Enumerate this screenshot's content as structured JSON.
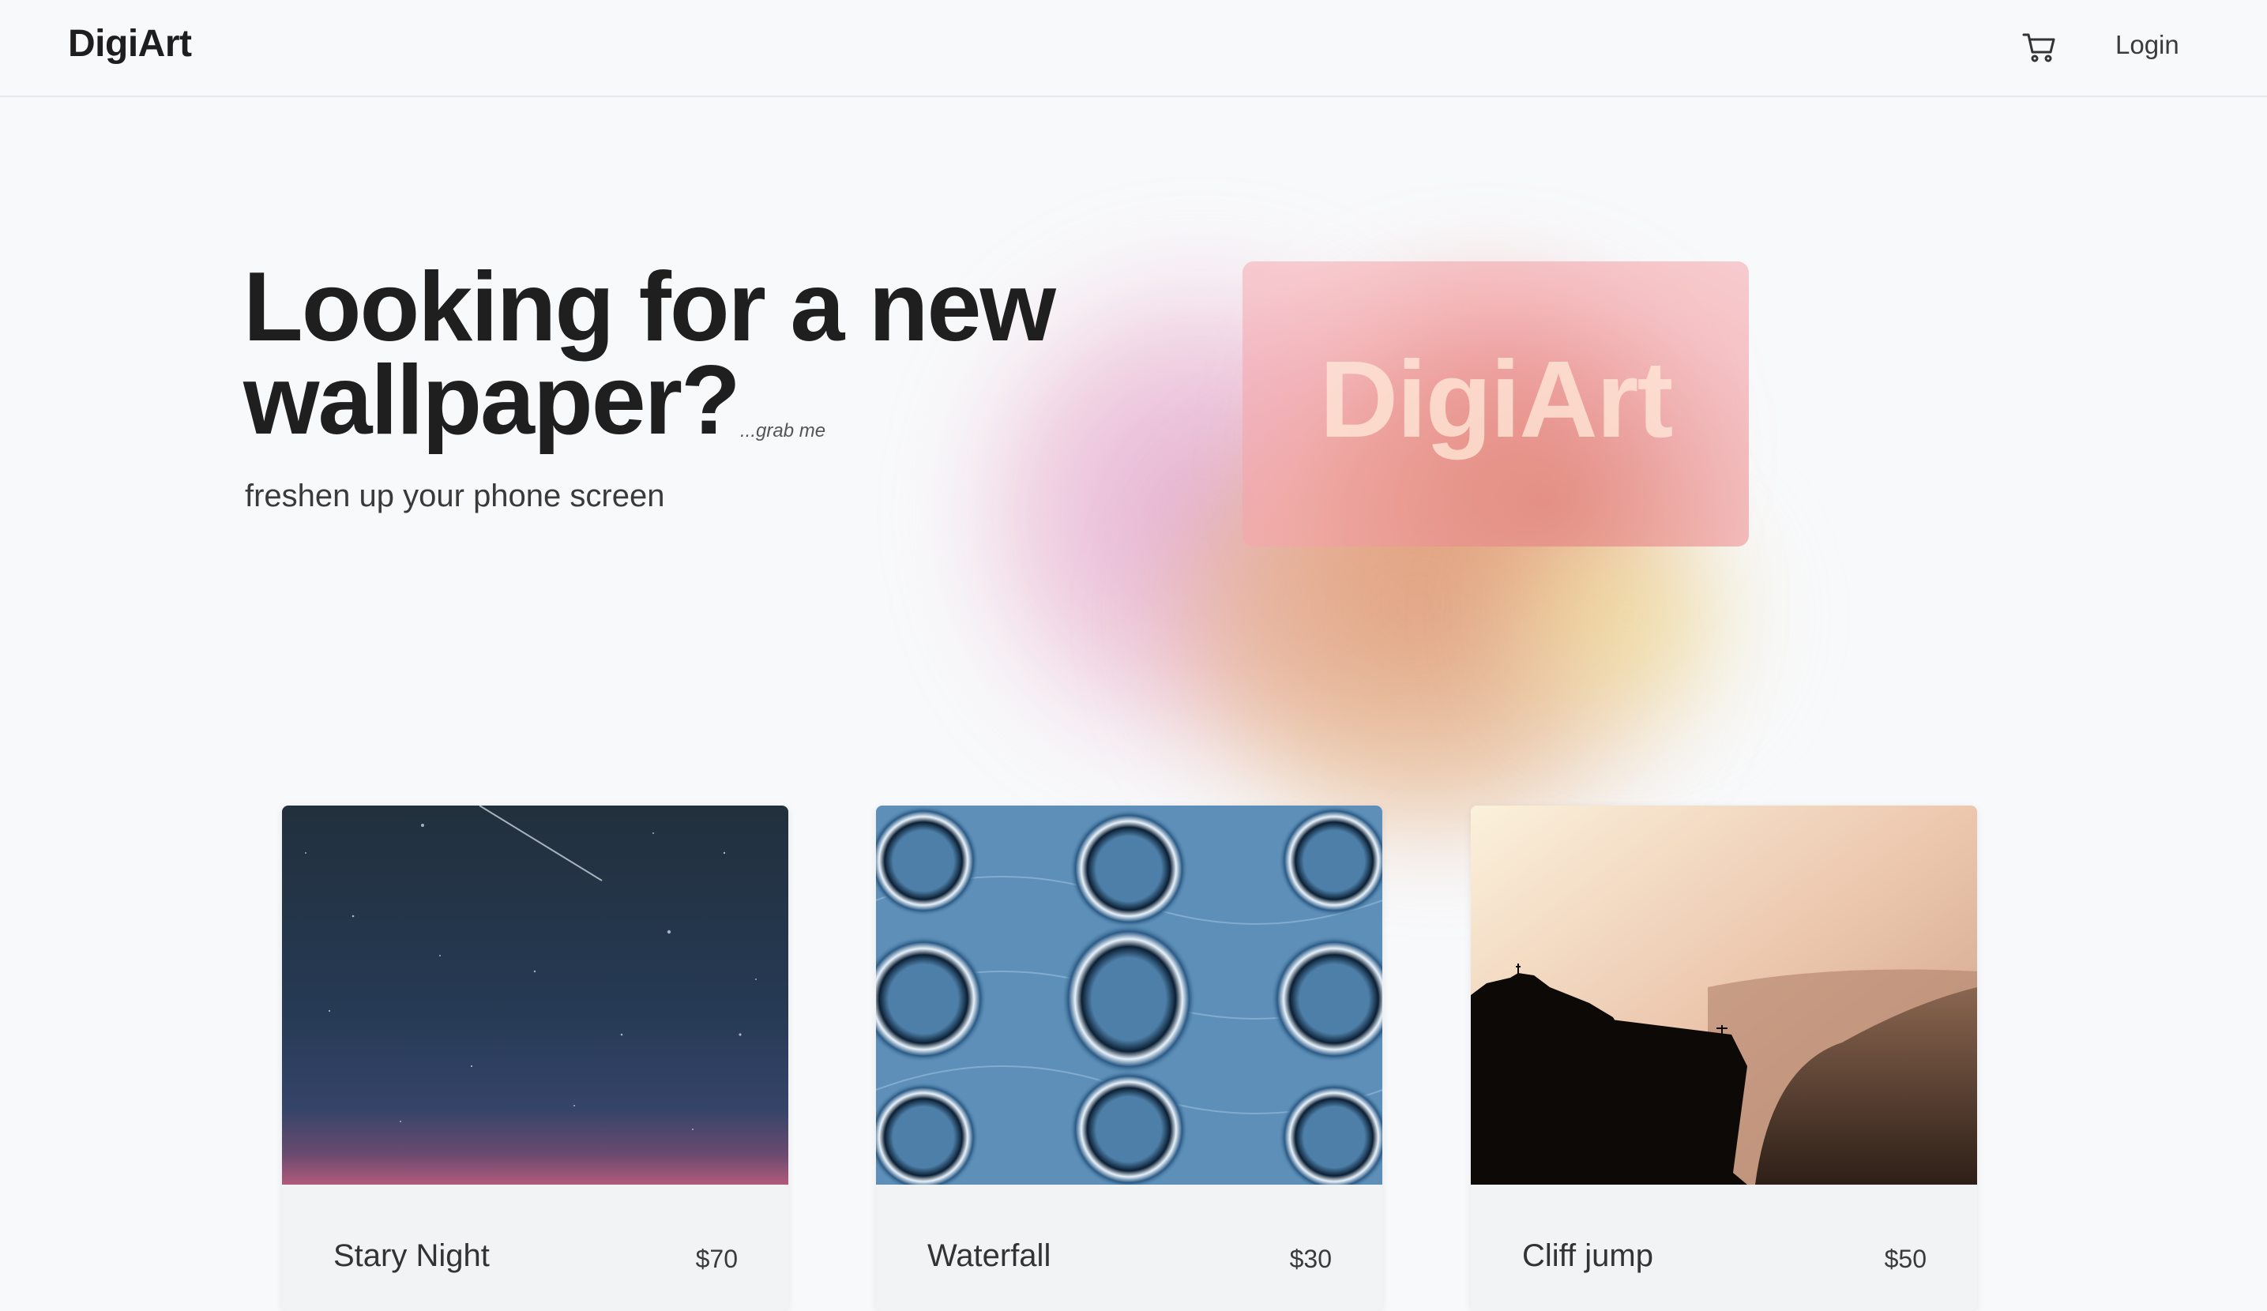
{
  "navbar": {
    "brand": "DigiArt",
    "cart_icon": "cart-icon",
    "login_label": "Login"
  },
  "hero": {
    "title_line1": "Looking for a new",
    "title_line2": "wallpaper?",
    "tagline": "...grab me",
    "subtitle": "freshen up your phone screen",
    "card_text": "DigiArt"
  },
  "products": [
    {
      "name": "Stary Night",
      "price": "$70"
    },
    {
      "name": "Waterfall",
      "price": "$30"
    },
    {
      "name": "Cliff jump",
      "price": "$50"
    }
  ],
  "colors": {
    "background": "#f8f9fb",
    "text": "#1f1f1f",
    "card": "#f2f3f5"
  }
}
